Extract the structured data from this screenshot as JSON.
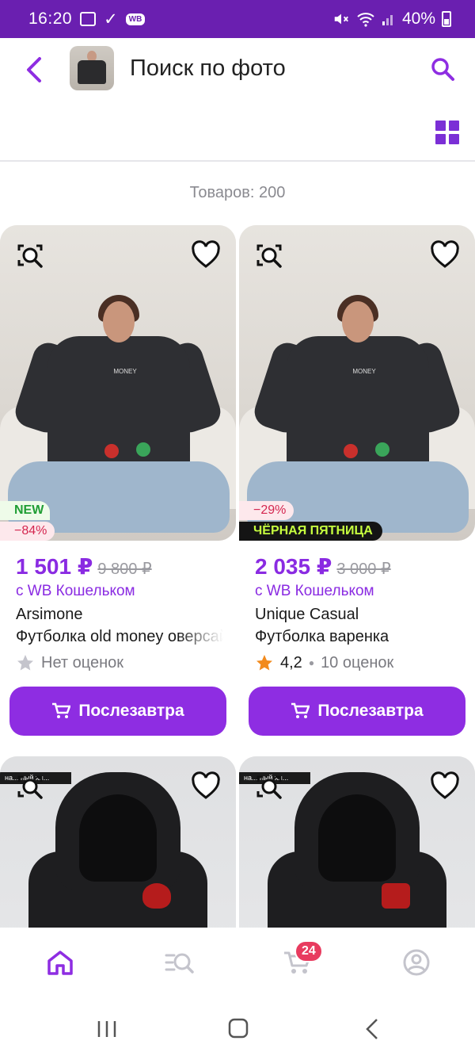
{
  "status_bar": {
    "time": "16:20",
    "wb_label": "WB",
    "battery": "40%"
  },
  "header": {
    "title": "Поиск по фото"
  },
  "results": {
    "count_text": "Товаров: 200"
  },
  "products": [
    {
      "badge_new": "NEW",
      "discount": "−84%",
      "price": "1 501 ₽",
      "old_price": "9 800 ₽",
      "wallet": "с WB Кошельком",
      "brand": "Arsimone",
      "name": "Футболка old money оверсайз",
      "rating_text": "Нет оценок",
      "button": "Послезавтра",
      "tee_text": "MONEY"
    },
    {
      "discount": "−29%",
      "promo": "ЧЁРНАЯ ПЯТНИЦА",
      "price": "2 035 ₽",
      "old_price": "3 000 ₽",
      "wallet": "с WB Кошельком",
      "brand": "Unique Casual",
      "name": "Футболка варенка",
      "rating_value": "4,2",
      "rating_count": "10 оценок",
      "button": "Послезавтра",
      "tee_text": "MONEY"
    },
    {
      "corner_tag": "на... ный хл..."
    },
    {
      "corner_tag": "на... ный хл..."
    }
  ],
  "bottom_nav": {
    "cart_count": "24",
    "items": [
      "home-icon",
      "catalog-search-icon",
      "cart-icon",
      "profile-icon"
    ]
  },
  "colors": {
    "accent": "#8e2de2",
    "status_bar": "#6a1fb0",
    "discount": "#d4264f",
    "new": "#1f9d34"
  }
}
